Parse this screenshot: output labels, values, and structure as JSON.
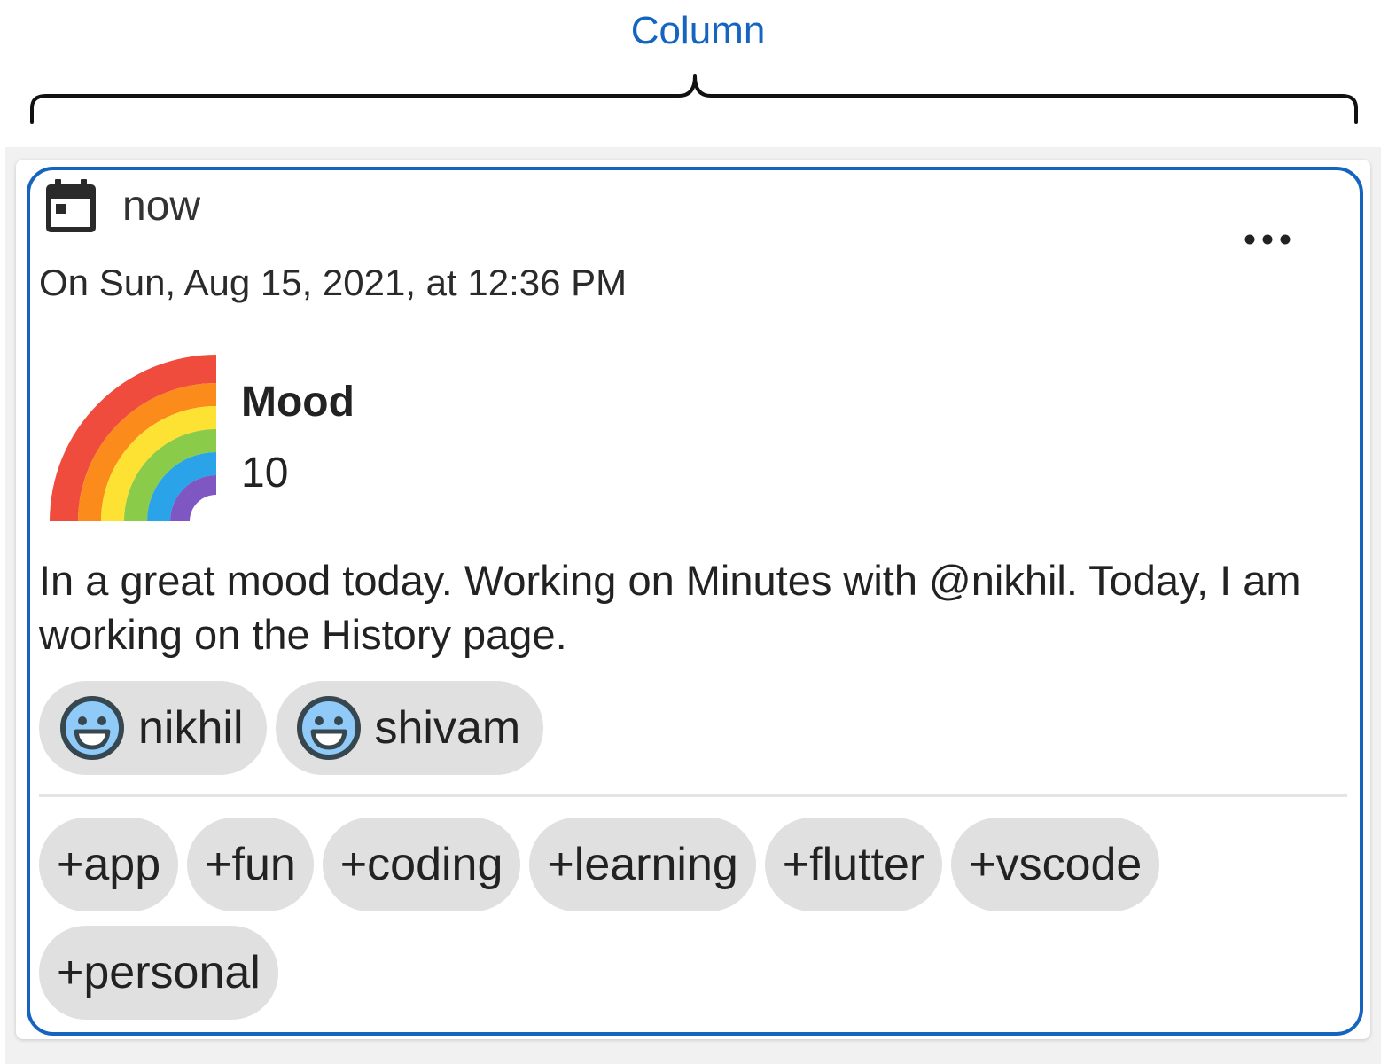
{
  "annotation": {
    "label": "Column"
  },
  "entry": {
    "time_label": "now",
    "date_line": "On Sun, Aug 15, 2021, at 12:36 PM",
    "mood": {
      "title": "Mood",
      "value": "10",
      "emoji": "rainbow-icon"
    },
    "note": "In a great mood today. Working on Minutes with @nikhil. Today, I am working on the History page.",
    "people": [
      {
        "name": "nikhil",
        "icon": "smiley-face-icon"
      },
      {
        "name": "shivam",
        "icon": "smiley-face-icon"
      }
    ],
    "tags": [
      "+app",
      "+fun",
      "+coding",
      "+learning",
      "+flutter",
      "+vscode",
      "+personal"
    ]
  },
  "colors": {
    "highlight": "#1565c0",
    "chip_background": "#e0e0e0",
    "face_fill": "#90caf9",
    "face_stroke": "#37474f"
  }
}
